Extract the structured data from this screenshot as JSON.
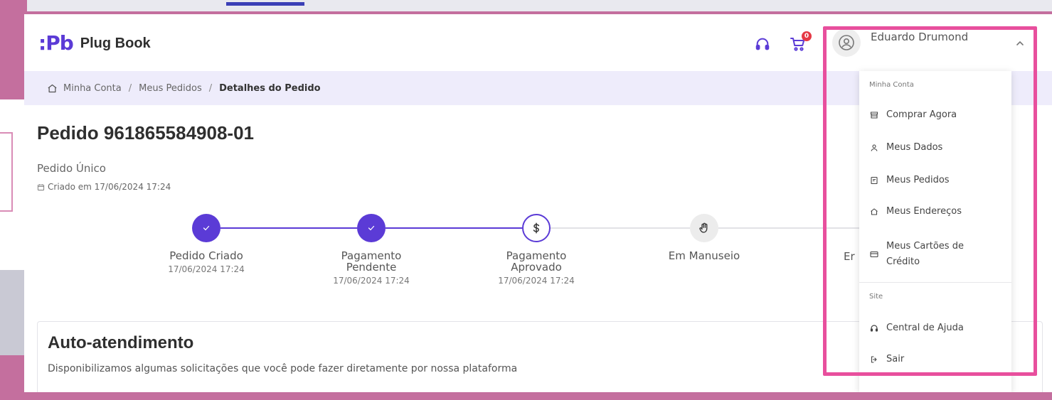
{
  "brand": {
    "logo_mark": ":Pb",
    "name": "Plug Book"
  },
  "header": {
    "cart_count": "0",
    "user_name": "Eduardo Drumond"
  },
  "breadcrumb": {
    "items": [
      "Minha Conta",
      "Meus Pedidos",
      "Detalhes do Pedido"
    ],
    "separator": "/"
  },
  "order": {
    "title": "Pedido 961865584908-01",
    "type": "Pedido Único",
    "created": "Criado em 17/06/2024 17:24"
  },
  "steps": [
    {
      "label": "Pedido Criado",
      "date": "17/06/2024 17:24",
      "state": "done"
    },
    {
      "label": "Pagamento Pendente",
      "date": "17/06/2024 17:24",
      "state": "done"
    },
    {
      "label": "Pagamento Aprovado",
      "date": "17/06/2024 17:24",
      "state": "current"
    },
    {
      "label": "Em Manuseio",
      "date": "",
      "state": "future"
    },
    {
      "label": "Er",
      "date": "",
      "state": "future"
    }
  ],
  "self_service": {
    "title": "Auto-atendimento",
    "description": "Disponibilizamos algumas solicitações que você pode fazer diretamente por nossa plataforma"
  },
  "dropdown": {
    "section_account": "Minha Conta",
    "items_account": [
      {
        "label": "Comprar Agora",
        "icon": "store-icon"
      },
      {
        "label": "Meus Dados",
        "icon": "person-icon"
      },
      {
        "label": "Meus Pedidos",
        "icon": "orders-icon"
      },
      {
        "label": "Meus Endereços",
        "icon": "home-icon"
      },
      {
        "label": "Meus Cartões de Crédito",
        "icon": "credit-card-icon"
      }
    ],
    "section_site": "Site",
    "items_site": [
      {
        "label": "Central de Ajuda",
        "icon": "headset-icon"
      },
      {
        "label": "Sair",
        "icon": "logout-icon"
      }
    ]
  },
  "colors": {
    "accent": "#5b3bd6",
    "highlight": "#e84f9d",
    "background": "#c46f9e",
    "badge": "#e53945"
  }
}
